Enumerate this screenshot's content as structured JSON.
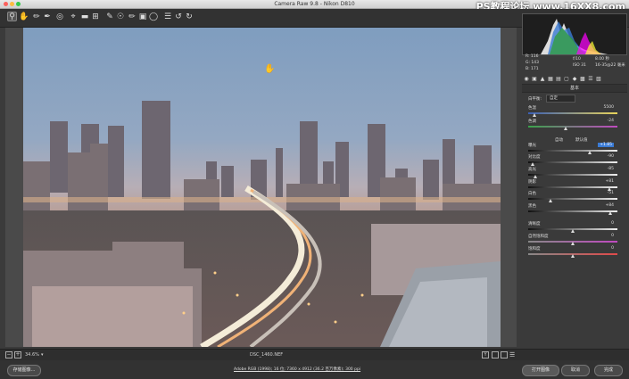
{
  "window": {
    "title": "Camera Raw 9.8  -  Nikon D810"
  },
  "watermark": "PS教程论坛 www.16XX8.com",
  "toolbar": {
    "tools": [
      "zoom-tool-icon",
      "hand-tool-icon",
      "white-balance-tool-icon",
      "color-sampler-tool-icon",
      "targeted-adjustment-tool-icon",
      "crop-tool-icon",
      "straighten-tool-icon",
      "transform-tool-icon",
      "spot-removal-tool-icon",
      "red-eye-tool-icon",
      "adjustment-brush-icon",
      "graduated-filter-icon",
      "radial-filter-icon",
      "preferences-icon",
      "rotate-ccw-icon",
      "rotate-cw-icon"
    ]
  },
  "readout": {
    "r": "R:  116",
    "g": "G:  143",
    "b": "B:  171",
    "aperture": "f/10",
    "shutter": "8.00 秒",
    "iso": "ISO 31",
    "lens": "16-35@22 毫米"
  },
  "panel": {
    "section_title": "基本",
    "white_balance_label": "白平衡:",
    "white_balance_value": "自定",
    "auto_label": "自动",
    "default_label": "默认值",
    "sliders": [
      {
        "label": "色温",
        "value": "5500"
      },
      {
        "label": "色调",
        "value": "-24"
      },
      {
        "label": "曝光",
        "value": "+1.85"
      },
      {
        "label": "对比度",
        "value": "-90"
      },
      {
        "label": "高光",
        "value": "-85"
      },
      {
        "label": "阴影",
        "value": "+81"
      },
      {
        "label": "白色",
        "value": "-51"
      },
      {
        "label": "黑色",
        "value": "+84"
      },
      {
        "label": "清晰度",
        "value": "0"
      },
      {
        "label": "自然饱和度",
        "value": "0"
      },
      {
        "label": "饱和度",
        "value": "0"
      }
    ]
  },
  "status": {
    "zoom": "34.6%",
    "filename": "DSC_1460.NEF"
  },
  "bottom": {
    "save_label": "存储图像...",
    "info": "Adobe RGB (1998); 16 位; 7360 x 4912 (36.2 百万像素); 300 ppi",
    "open_label": "打开图像",
    "cancel_label": "取消",
    "done_label": "完成"
  },
  "colors": {
    "accent": "#3a7bd5",
    "background": "#3b3b3b"
  }
}
